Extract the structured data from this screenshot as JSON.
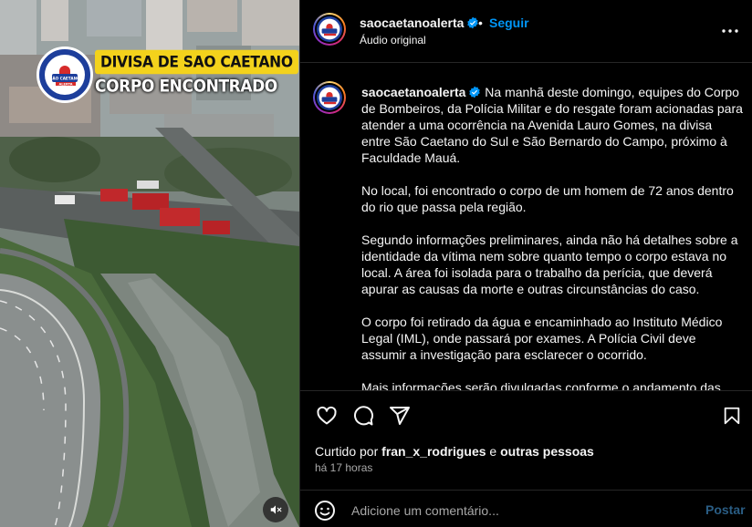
{
  "media": {
    "overlay_line1": "DIVISA DE SAO CAETANO",
    "overlay_line2": "CORPO ENCONTRADO",
    "logo_text_top": "SÃO CAETANO",
    "logo_text_bottom": "ALERTA",
    "mute_icon": "speaker-muted-icon"
  },
  "header": {
    "username": "saocaetanoalerta",
    "separator": "•",
    "follow_label": "Seguir",
    "audio_label": "Áudio original",
    "more_icon": "more-options-icon"
  },
  "caption": {
    "username": "saocaetanoalerta",
    "paragraphs": [
      "Na manhã deste domingo, equipes do Corpo de Bombeiros, da Polícia Militar e do resgate foram acionadas para atender a uma ocorrência na Avenida Lauro Gomes, na divisa entre São Caetano do Sul e São Bernardo do Campo, próximo à Faculdade Mauá.",
      "No local, foi encontrado o corpo de um homem de 72 anos dentro do rio que passa pela região.",
      "Segundo informações preliminares, ainda não há detalhes sobre a identidade da vítima nem sobre quanto tempo o corpo estava no local. A área foi isolada para o trabalho da perícia, que deverá apurar as causas da morte e outras circunstâncias do caso.",
      "O corpo foi retirado da água e encaminhado ao Instituto Médico Legal (IML), onde passará por exames. A Polícia Civil deve assumir a investigação para esclarecer o ocorrido.",
      "Mais informações serão divulgadas conforme o andamento das"
    ]
  },
  "actions": {
    "like_icon": "heart-icon",
    "comment_icon": "comment-icon",
    "share_icon": "share-icon",
    "save_icon": "bookmark-icon",
    "liked_prefix": "Curtido por",
    "liked_user": "fran_x_rodrigues",
    "liked_conj": "e",
    "liked_others": "outras pessoas",
    "time_ago": "há 17 horas"
  },
  "comment": {
    "placeholder": "Adicione um comentário...",
    "post_label": "Postar",
    "emoji_icon": "emoji-icon"
  },
  "colors": {
    "accent": "#0095f6",
    "overlay_yellow": "#f3d21c",
    "verified": "#0095f6",
    "post_disabled": "#2a5d84"
  }
}
